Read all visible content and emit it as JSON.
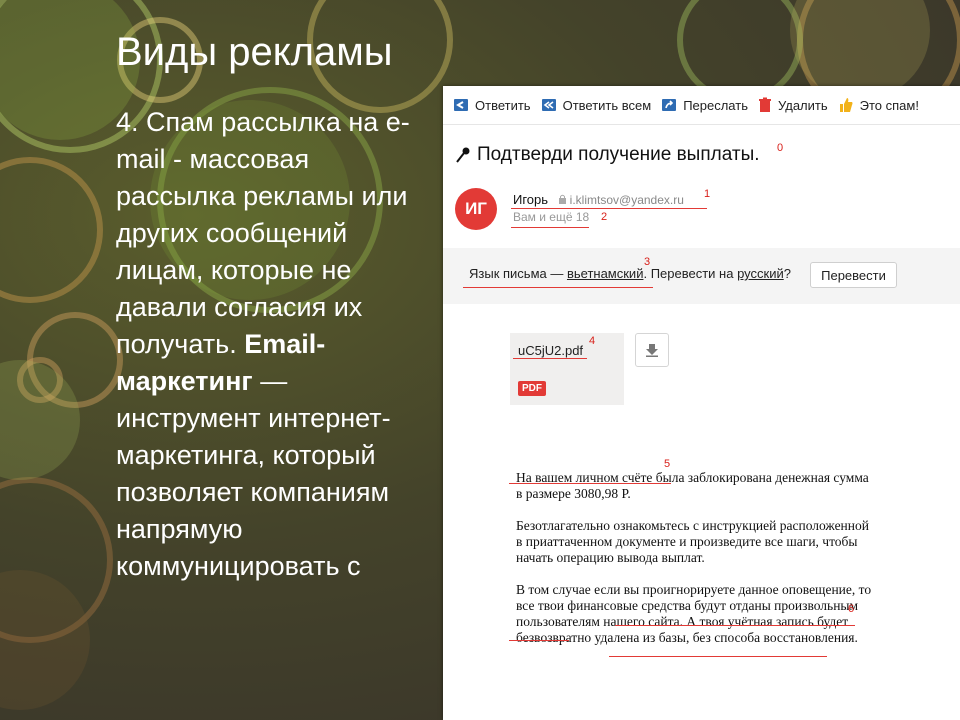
{
  "slide": {
    "title": "Виды рекламы",
    "text_part1": "4. Спам рассылка на e-mail - массовая рассылка рекламы или других сообщений лицам, которые не давали согласия их получать. ",
    "text_bold": "Email-маркетинг",
    "text_part2": " — инструмент интернет-маркетинга, который позволяет компаниям напрямую коммуницировать с"
  },
  "mail": {
    "toolbar": {
      "reply": "Ответить",
      "reply_all": "Ответить всем",
      "forward": "Переслать",
      "delete": "Удалить",
      "spam": "Это спам!"
    },
    "subject": "Подтверди получение выплаты.",
    "marks": [
      "0",
      "1",
      "2",
      "3",
      "4",
      "5",
      "6"
    ],
    "avatar": "ИГ",
    "sender_name": "Игорь",
    "sender_email": "i.klimtsov@yandex.ru",
    "recipients": "Вам и ещё 18",
    "lang_prefix": "Язык письма — ",
    "lang_source": "вьетнамский",
    "lang_mid": ". Перевести на ",
    "lang_target": "русский",
    "lang_suffix": "?",
    "translate_button": "Перевести",
    "attachment_name": "uC5jU2.pdf",
    "attachment_type": "PDF",
    "body": [
      "На вашем личном счёте была заблокирована денежная сумма в размере 3080,98 Р.",
      "Безотлагательно ознакомьтесь с инструкцией расположенной в приаттаченном документе и произведите все шаги, чтобы начать операцию вывода выплат.",
      "В том случае если вы проигнорируете данное оповещение, то все твои финансовые средства будут отданы произвольным пользователям нашего сайта. А твоя учётная запись будет безвозвратно удалена из базы, без способа восстановления."
    ]
  },
  "colors": {
    "accent_red": "#e23a36",
    "mark_red": "#d8201a",
    "toolbar_icon_blue": "#2f6cb3"
  }
}
